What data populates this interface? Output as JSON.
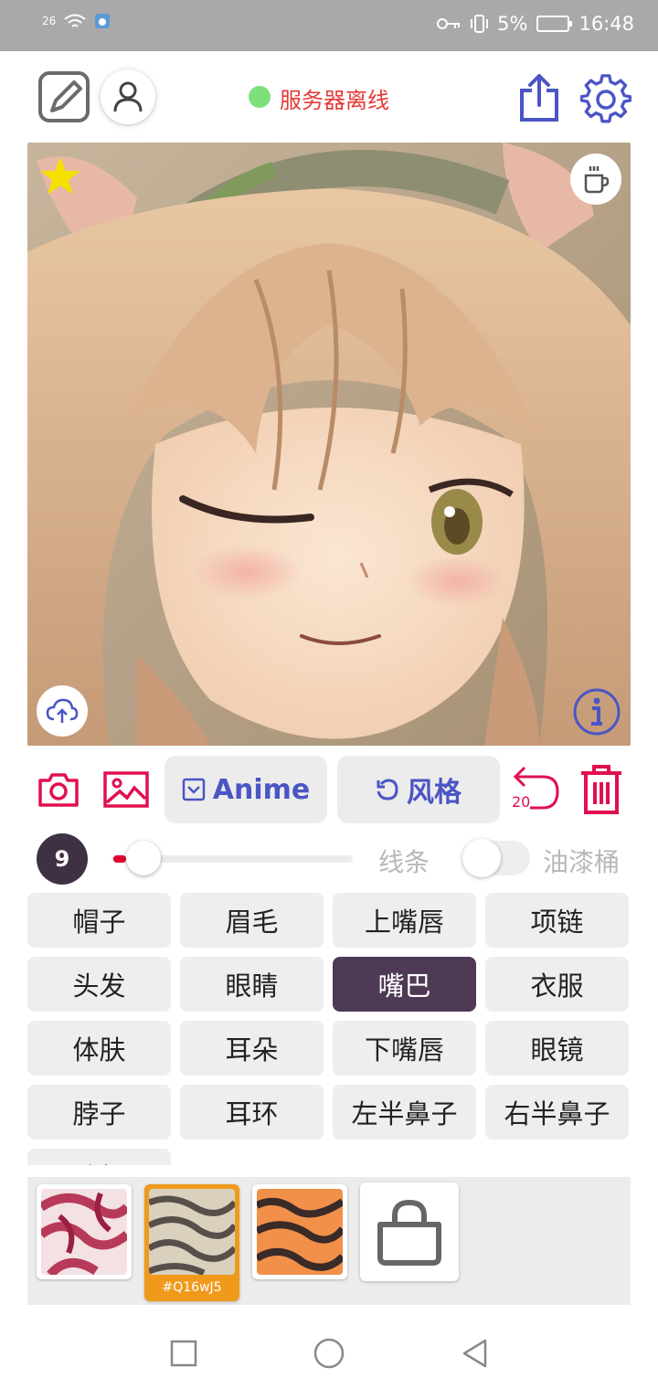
{
  "status_bar": {
    "signal": "26",
    "battery": "5%",
    "time": "16:48"
  },
  "header": {
    "server_status": "服务器离线",
    "status_color": "#7ee07b",
    "icons": [
      "edit-icon",
      "user-icon",
      "share-icon",
      "settings-icon"
    ]
  },
  "canvas": {
    "icons": [
      "star-icon",
      "coffee-icon",
      "upload-cloud-icon",
      "info-icon"
    ]
  },
  "toolbar": {
    "mode_label": "Anime",
    "style_label": "风格",
    "undo_count": "20",
    "icons": [
      "camera-icon",
      "image-icon",
      "undo-icon",
      "trash-icon"
    ]
  },
  "brush": {
    "size": "9",
    "slider_level": 0.05,
    "line_label": "线条",
    "bucket_label": "油漆桶",
    "bucket_enabled": false
  },
  "parts": [
    "帽子",
    "眉毛",
    "上嘴唇",
    "项链",
    "头发",
    "眼睛",
    "嘴巴",
    "衣服",
    "体肤",
    "耳朵",
    "下嘴唇",
    "眼镜",
    "脖子",
    "耳环",
    "左半鼻子",
    "右半鼻子",
    "脸颊"
  ],
  "selected_part": "嘴巴",
  "textures": {
    "selected_code": "#Q16wJ5",
    "selected_color": "#f09a1c"
  }
}
